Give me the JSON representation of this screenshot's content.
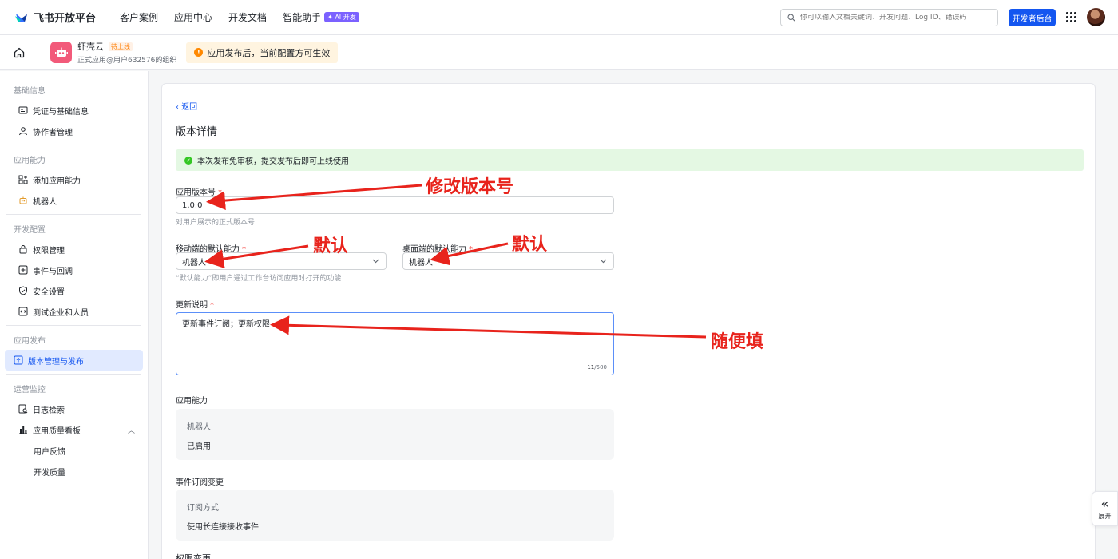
{
  "header": {
    "logo_text": "飞书开放平台",
    "nav": [
      "客户案例",
      "应用中心",
      "开发文档",
      "智能助手"
    ],
    "ai_badge": "✦ AI 开发",
    "search_placeholder": "你可以输入文档关键词、开发问题、Log ID、错误码",
    "dev_button": "开发者后台"
  },
  "app": {
    "name": "虾壳云",
    "status_tag": "待上线",
    "org": "正式应用@用户632576的组织",
    "notice": "应用发布后，当前配置方可生效"
  },
  "sidebar": {
    "groups": [
      {
        "title": "基础信息",
        "items": [
          "凭证与基础信息",
          "协作者管理"
        ]
      },
      {
        "title": "应用能力",
        "items": [
          "添加应用能力",
          "机器人"
        ]
      },
      {
        "title": "开发配置",
        "items": [
          "权限管理",
          "事件与回调",
          "安全设置",
          "测试企业和人员"
        ]
      },
      {
        "title": "应用发布",
        "items": [
          "版本管理与发布"
        ]
      },
      {
        "title": "运营监控",
        "items": [
          "日志检索",
          "应用质量看板",
          "用户反馈",
          "开发质量"
        ]
      }
    ]
  },
  "main": {
    "back": "返回",
    "title": "版本详情",
    "success_msg": "本次发布免审核，提交发布后即可上线使用",
    "version_label": "应用版本号",
    "version_value": "1.0.0",
    "version_hint": "对用户展示的正式版本号",
    "mobile_label": "移动端的默认能力",
    "mobile_value": "机器人",
    "desktop_label": "桌面端的默认能力",
    "desktop_value": "机器人",
    "default_hint": "“默认能力”即用户通过工作台访问应用时打开的功能",
    "notes_label": "更新说明",
    "notes_value": "更新事件订阅；更新权限",
    "notes_count": "11",
    "notes_max": "/500",
    "ability_title": "应用能力",
    "ability_key": "机器人",
    "ability_value": "已启用",
    "event_title": "事件订阅变更",
    "event_key": "订阅方式",
    "event_value": "使用长连接接收事件",
    "perm_title": "权限变更"
  },
  "annotations": {
    "a1": "修改版本号",
    "a2": "默认",
    "a3": "默认",
    "a4": "随便填",
    "color": "#e8231c"
  },
  "expand": {
    "label": "展开"
  }
}
